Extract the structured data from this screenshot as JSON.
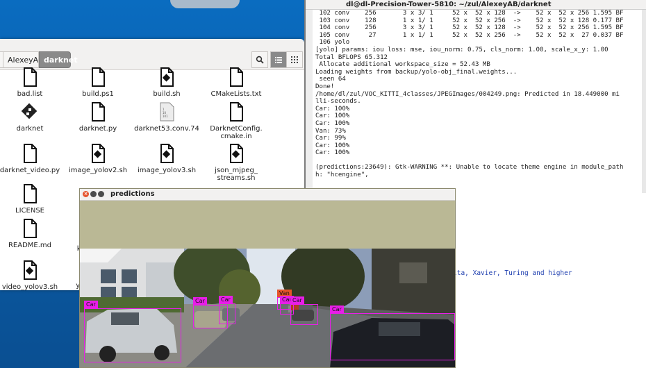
{
  "file_manager": {
    "breadcrumbs": [
      "",
      "AlexeyAB",
      "darknet"
    ],
    "view": {
      "list_icon": "list-icon",
      "grid_icon": "grid-icon",
      "search_icon": "search-icon"
    },
    "files": [
      {
        "name": "bad.list",
        "icon": "text-file-icon"
      },
      {
        "name": "build.ps1",
        "icon": "text-file-icon"
      },
      {
        "name": "build.sh",
        "icon": "script-icon"
      },
      {
        "name": "CMakeLists.txt",
        "icon": "text-file-icon"
      },
      {
        "name": "darknet",
        "icon": "executable-icon"
      },
      {
        "name": "darknet.py",
        "icon": "text-file-icon"
      },
      {
        "name": "darknet53.conv.74",
        "icon": "binary-file-icon"
      },
      {
        "name": "DarknetConfig.\ncmake.in",
        "icon": "text-file-icon"
      },
      {
        "name": "darknet_video.py",
        "icon": "text-file-icon"
      },
      {
        "name": "image_yolov2.sh",
        "icon": "script-icon"
      },
      {
        "name": "image_yolov3.sh",
        "icon": "script-icon"
      },
      {
        "name": "json_mjpeg_\nstreams.sh",
        "icon": "script-icon"
      },
      {
        "name": "LICENSE",
        "icon": "text-file-icon"
      },
      {
        "name": "README.md",
        "icon": "text-file-icon"
      },
      {
        "name": "video_yolov3.sh",
        "icon": "script-icon"
      }
    ],
    "partial_labels": [
      "ki",
      "yc"
    ]
  },
  "terminal": {
    "title": "dl@dl-Precision-Tower-5810: ~/zul/AlexeyAB/darknet",
    "lines": [
      " 102 conv    256       3 x 3/ 1     52 x  52 x 128  ->    52 x  52 x 256 1.595 BF",
      " 103 conv    128       1 x 1/ 1     52 x  52 x 256  ->    52 x  52 x 128 0.177 BF",
      " 104 conv    256       3 x 3/ 1     52 x  52 x 128  ->    52 x  52 x 256 1.595 BF",
      " 105 conv     27       1 x 1/ 1     52 x  52 x 256  ->    52 x  52 x  27 0.037 BF",
      " 106 yolo",
      "[yolo] params: iou loss: mse, iou_norm: 0.75, cls_norm: 1.00, scale_x_y: 1.00",
      "Total BFLOPS 65.312",
      " Allocate additional workspace_size = 52.43 MB",
      "Loading weights from backup/yolo-obj_final.weights...",
      " seen 64",
      "Done!",
      "/home/dl/zul/VOC_KITTI_4classes/JPEGImages/004249.png: Predicted in 18.449000 mi",
      "lli-seconds.",
      "Car: 100%",
      "Car: 100%",
      "Car: 100%",
      "Van: 73%",
      "Car: 99%",
      "Car: 100%",
      "Car: 100%",
      "",
      "(predictions:23649): Gtk-WARNING **: Unable to locate theme engine in module_path",
      "h: \"hcengine\","
    ],
    "background_text": "lta, Xavier, Turing and higher"
  },
  "predictions_window": {
    "title": "predictions",
    "detections": [
      {
        "label": "Car"
      },
      {
        "label": "Car"
      },
      {
        "label": "Car"
      },
      {
        "label": "Van"
      },
      {
        "label": "Car"
      },
      {
        "label": "Car"
      },
      {
        "label": "Car"
      }
    ]
  },
  "colors": {
    "box": "#e81ee8",
    "van_label": "#e4542a",
    "desktop": "#0b5ea8",
    "image_bg": "#bab895"
  }
}
